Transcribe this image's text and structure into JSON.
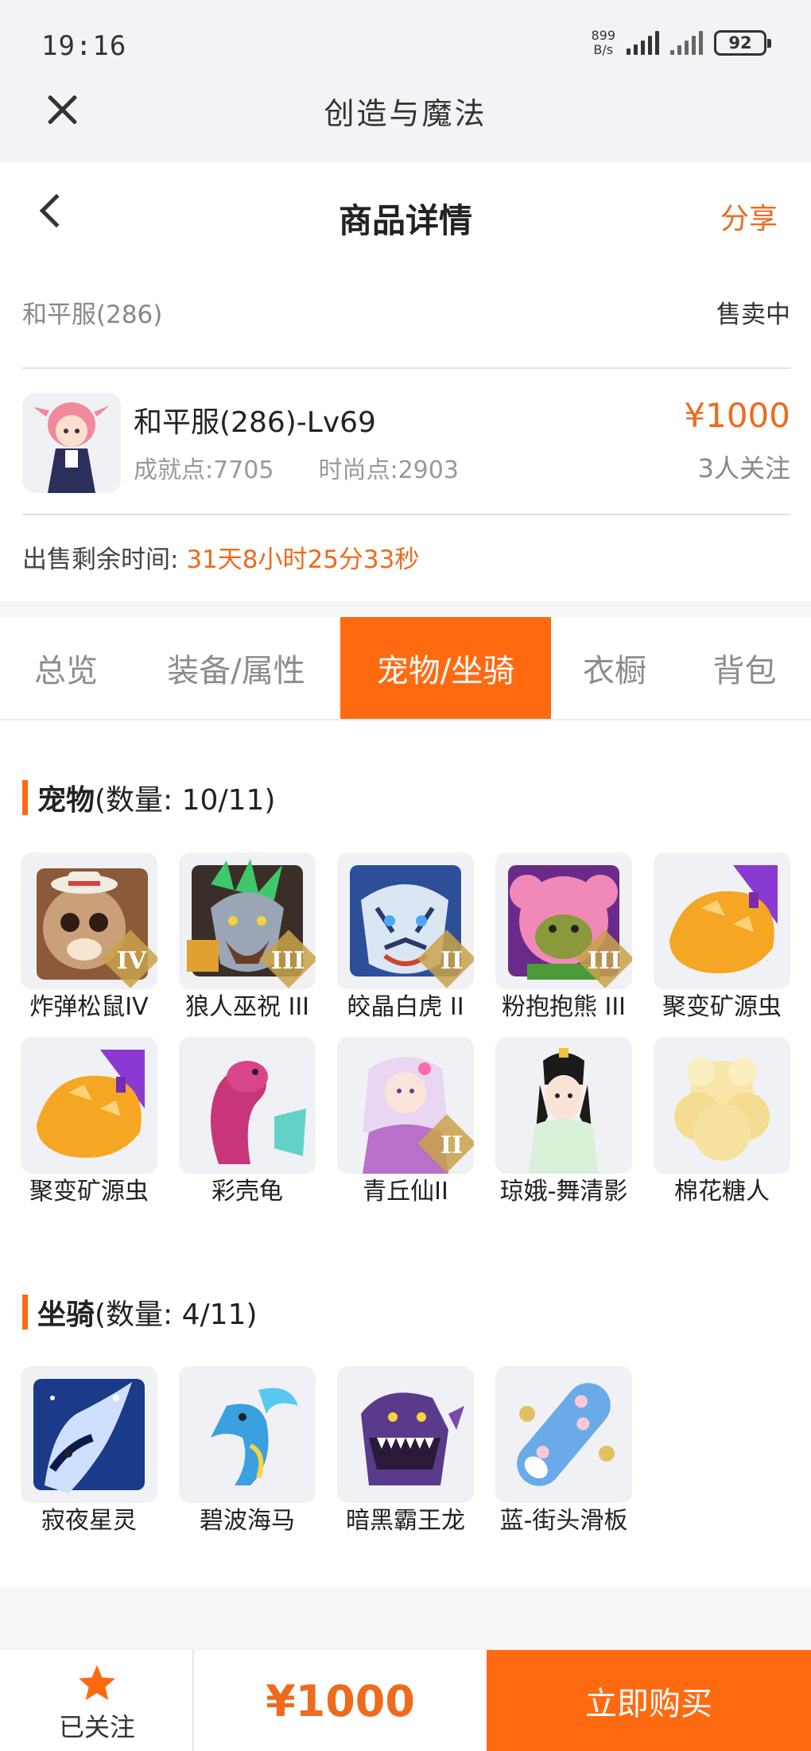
{
  "status_bar": {
    "time": "19:16",
    "net_speed_value": "899",
    "net_speed_unit": "B/s",
    "battery": "92"
  },
  "app": {
    "title": "创造与魔法"
  },
  "header": {
    "title": "商品详情",
    "share_label": "分享"
  },
  "product": {
    "server": "和平服(286)",
    "status": "售卖中",
    "name": "和平服(286)-Lv69",
    "achievement": "成就点:7705",
    "fashion": "时尚点:2903",
    "price": "¥1000",
    "followers": "3人关注",
    "remain_label": "出售剩余时间:",
    "remain_time": "31天8小时25分33秒"
  },
  "tabs": [
    {
      "label": "总览",
      "active": false
    },
    {
      "label": "装备/属性",
      "active": false
    },
    {
      "label": "宠物/坐骑",
      "active": true
    },
    {
      "label": "衣橱",
      "active": false
    },
    {
      "label": "背包",
      "active": false
    }
  ],
  "pets": {
    "title": "宠物",
    "count": "(数量: 10/11)",
    "items": [
      {
        "name": "炸弹松鼠IV",
        "rank": "IV"
      },
      {
        "name": "狼人巫祝 III",
        "rank": "III"
      },
      {
        "name": "皎晶白虎 II",
        "rank": "II"
      },
      {
        "name": "粉抱抱熊 III",
        "rank": "III"
      },
      {
        "name": "聚变矿源虫"
      },
      {
        "name": "聚变矿源虫"
      },
      {
        "name": "彩壳龟"
      },
      {
        "name": "青丘仙II",
        "rank": "II"
      },
      {
        "name": "琼娥-舞清影"
      },
      {
        "name": "棉花糖人"
      }
    ]
  },
  "mounts": {
    "title": "坐骑",
    "count": "(数量: 4/11)",
    "items": [
      {
        "name": "寂夜星灵"
      },
      {
        "name": "碧波海马"
      },
      {
        "name": "暗黑霸王龙"
      },
      {
        "name": "蓝-街头滑板"
      }
    ]
  },
  "bottom_bar": {
    "follow_label": "已关注",
    "price": "¥1000",
    "buy_label": "立即购买"
  },
  "colors": {
    "accent": "#ff6a10",
    "price": "#ee6a1d"
  }
}
